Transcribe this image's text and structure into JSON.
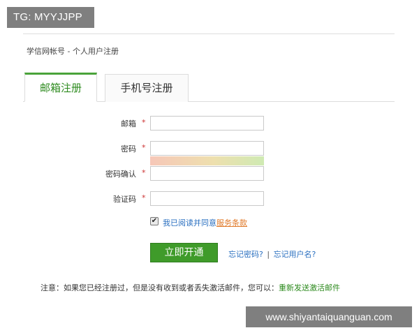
{
  "badge": {
    "text": "TG: MYYJJPP"
  },
  "breadcrumb": "学信网帐号 - 个人用户注册",
  "tabs": [
    {
      "label": "邮箱注册",
      "active": true
    },
    {
      "label": "手机号注册",
      "active": false
    }
  ],
  "form": {
    "required_mark": "*",
    "fields": [
      {
        "label": "邮箱",
        "value": ""
      },
      {
        "label": "密码",
        "value": ""
      },
      {
        "label": "密码确认",
        "value": ""
      },
      {
        "label": "验证码",
        "value": ""
      }
    ],
    "agree": {
      "checked": true,
      "check_glyph": "✔",
      "text": "我已阅读并同意",
      "terms_link": "服务条款"
    },
    "submit_label": "立即开通",
    "forgot_password": "忘记密码?",
    "separator": "|",
    "forgot_username": "忘记用户名?"
  },
  "notice": {
    "text": "注意：如果您已经注册过，但是没有收到或者丢失激活邮件，您可以：",
    "resend_link": "重新发送激活邮件"
  },
  "watermark": {
    "text": "www.shiyantaiquanguan.com"
  },
  "colors": {
    "accent_green": "#3f9b2a",
    "link_blue": "#2a6fc0",
    "terms_orange": "#e07a2a",
    "required_red": "#cc3333"
  }
}
